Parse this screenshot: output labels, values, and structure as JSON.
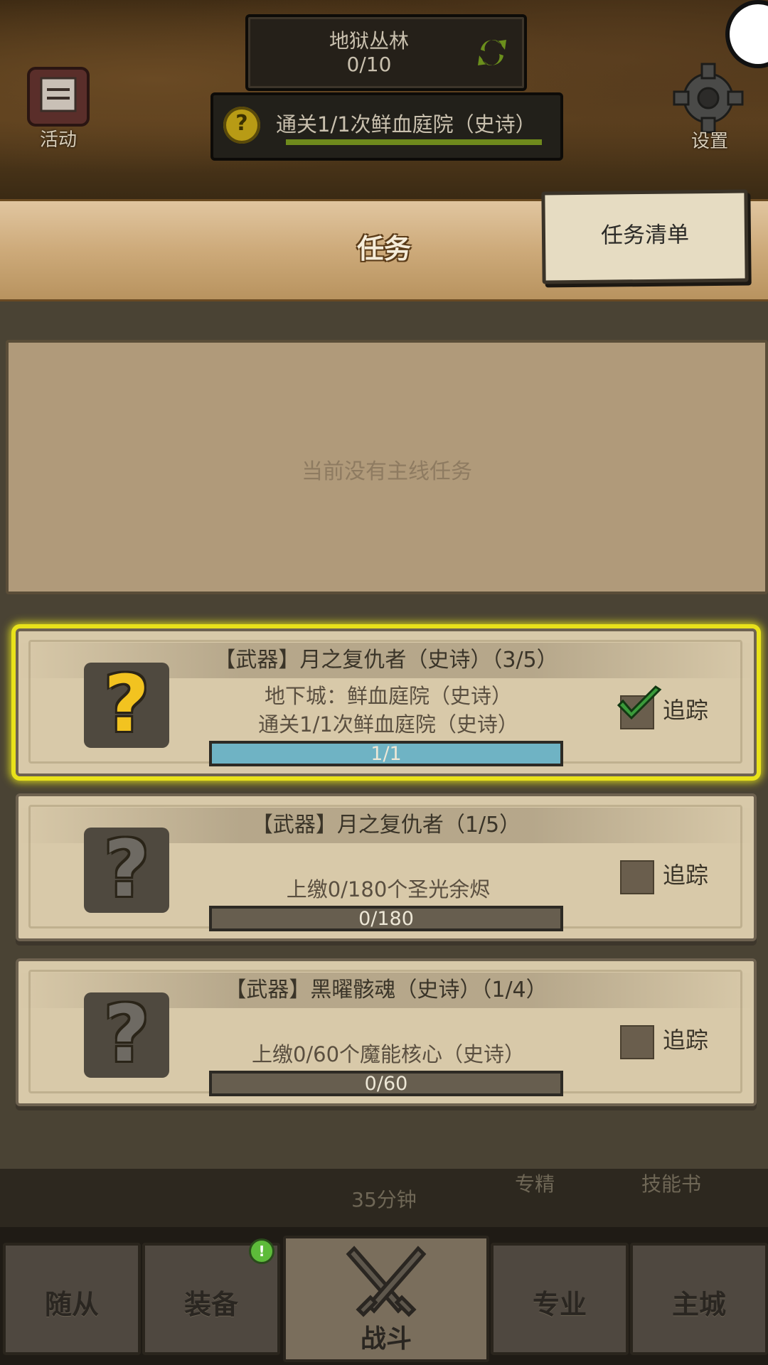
{
  "top": {
    "zone_name": "地狱丛林",
    "zone_progress": "0/10",
    "tracked_quest": "通关1/1次鲜血庭院（史诗）",
    "tracked_icon": "?",
    "left_button": "活动",
    "right_button": "设置"
  },
  "header": {
    "title": "任务",
    "list_button": "任务清单"
  },
  "main_quest": {
    "empty_text": "当前没有主线任务"
  },
  "quests": [
    {
      "title": "【武器】月之复仇者（史诗）（3/5）",
      "desc1": "地下城：鲜血庭院（史诗）",
      "desc2": "通关1/1次鲜血庭院（史诗）",
      "progress": "1/1",
      "progress_fraction": 1.0,
      "track_label": "追踪",
      "tracked": true,
      "icon_color": "#f2c320",
      "icon_char": "?"
    },
    {
      "title": "【武器】月之复仇者（1/5）",
      "desc1": "",
      "desc2": "上缴0/180个圣光余烬",
      "progress": "0/180",
      "progress_fraction": 0,
      "track_label": "追踪",
      "tracked": false,
      "icon_color": "#6e6a63",
      "icon_char": "?"
    },
    {
      "title": "【武器】黑曜骸魂（史诗）（1/4）",
      "desc1": "",
      "desc2": "上缴0/60个魔能核心（史诗）",
      "progress": "0/60",
      "progress_fraction": 0,
      "track_label": "追踪",
      "tracked": false,
      "icon_color": "#6e6a63",
      "icon_char": "?"
    }
  ],
  "bottom_strip": {
    "timer": "35分钟",
    "label_specialize": "专精",
    "label_skillbook": "技能书"
  },
  "nav": {
    "followers": "随从",
    "equipment": "装备",
    "battle": "战斗",
    "profession": "专业",
    "main_city": "主城",
    "equipment_badge": "!"
  }
}
